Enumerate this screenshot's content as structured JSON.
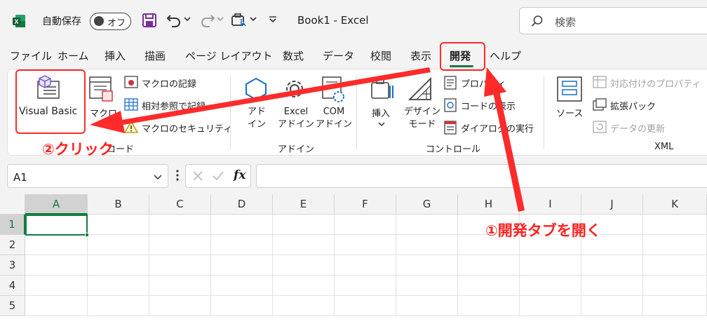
{
  "colors": {
    "accent": "#217346",
    "selection": "#107c41",
    "annotation": "#ff2020"
  },
  "titlebar": {
    "autosave_label": "自動保存",
    "autosave_state": "オフ",
    "doc_title": "Book1  -  Excel",
    "search_placeholder": "検索"
  },
  "tabs": [
    {
      "label": "ファイル"
    },
    {
      "label": "ホーム"
    },
    {
      "label": "挿入"
    },
    {
      "label": "描画"
    },
    {
      "label": "ページ レイアウト"
    },
    {
      "label": "数式"
    },
    {
      "label": "データ"
    },
    {
      "label": "校閲"
    },
    {
      "label": "表示"
    },
    {
      "label": "開発",
      "active": true
    },
    {
      "label": "ヘルプ"
    }
  ],
  "ribbon": {
    "code": {
      "visual_basic": "Visual Basic",
      "macro": "マクロ",
      "record_macro": "マクロの記録",
      "relative_ref": "相対参照で記録",
      "macro_security": "マクロのセキュリティ",
      "group_label": "コード"
    },
    "addins": {
      "addin": "アド\nイン",
      "excel_addin": "Excel\nアドイン",
      "com_addin": "COM\nアドイン",
      "group_label": "アドイン"
    },
    "controls": {
      "insert": "挿入",
      "design_mode": "デザイン\nモード",
      "properties": "プロパティ",
      "view_code": "コードの表示",
      "run_dialog": "ダイアログの実行",
      "group_label": "コントロール"
    },
    "xml": {
      "source": "ソース",
      "map_properties": "対応付けのプロパティ",
      "expansion_packs": "拡張パック",
      "refresh_data": "データの更新",
      "group_label": "XML"
    }
  },
  "formula_bar": {
    "name_box": "A1",
    "fx": "fx",
    "formula": ""
  },
  "grid": {
    "columns": [
      "A",
      "B",
      "C",
      "D",
      "E",
      "F",
      "G",
      "H",
      "I",
      "J",
      "K"
    ],
    "rows": [
      "1",
      "2",
      "3",
      "4",
      "5"
    ],
    "selected_cell": "A1"
  },
  "annotations": {
    "step1": "①開発タブを開く",
    "step2": "②クリック"
  }
}
